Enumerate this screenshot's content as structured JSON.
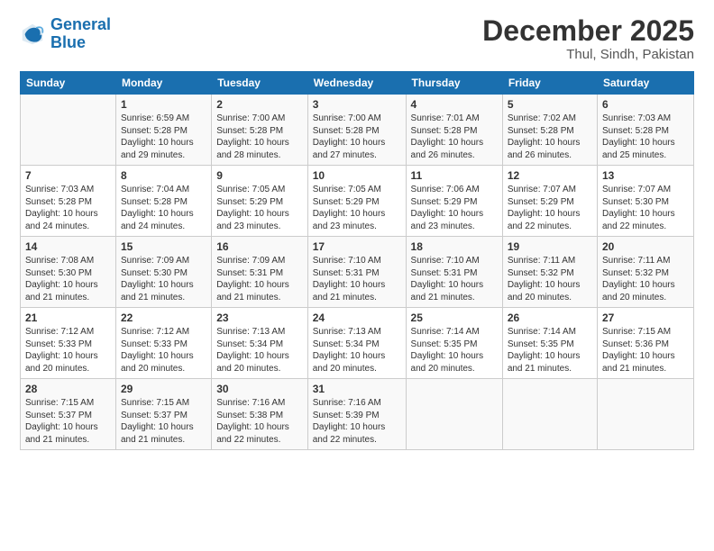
{
  "logo": {
    "text_general": "General",
    "text_blue": "Blue"
  },
  "header": {
    "month": "December 2025",
    "location": "Thul, Sindh, Pakistan"
  },
  "weekdays": [
    "Sunday",
    "Monday",
    "Tuesday",
    "Wednesday",
    "Thursday",
    "Friday",
    "Saturday"
  ],
  "weeks": [
    [
      {
        "day": "",
        "info": ""
      },
      {
        "day": "1",
        "info": "Sunrise: 6:59 AM\nSunset: 5:28 PM\nDaylight: 10 hours\nand 29 minutes."
      },
      {
        "day": "2",
        "info": "Sunrise: 7:00 AM\nSunset: 5:28 PM\nDaylight: 10 hours\nand 28 minutes."
      },
      {
        "day": "3",
        "info": "Sunrise: 7:00 AM\nSunset: 5:28 PM\nDaylight: 10 hours\nand 27 minutes."
      },
      {
        "day": "4",
        "info": "Sunrise: 7:01 AM\nSunset: 5:28 PM\nDaylight: 10 hours\nand 26 minutes."
      },
      {
        "day": "5",
        "info": "Sunrise: 7:02 AM\nSunset: 5:28 PM\nDaylight: 10 hours\nand 26 minutes."
      },
      {
        "day": "6",
        "info": "Sunrise: 7:03 AM\nSunset: 5:28 PM\nDaylight: 10 hours\nand 25 minutes."
      }
    ],
    [
      {
        "day": "7",
        "info": "Sunrise: 7:03 AM\nSunset: 5:28 PM\nDaylight: 10 hours\nand 24 minutes."
      },
      {
        "day": "8",
        "info": "Sunrise: 7:04 AM\nSunset: 5:28 PM\nDaylight: 10 hours\nand 24 minutes."
      },
      {
        "day": "9",
        "info": "Sunrise: 7:05 AM\nSunset: 5:29 PM\nDaylight: 10 hours\nand 23 minutes."
      },
      {
        "day": "10",
        "info": "Sunrise: 7:05 AM\nSunset: 5:29 PM\nDaylight: 10 hours\nand 23 minutes."
      },
      {
        "day": "11",
        "info": "Sunrise: 7:06 AM\nSunset: 5:29 PM\nDaylight: 10 hours\nand 23 minutes."
      },
      {
        "day": "12",
        "info": "Sunrise: 7:07 AM\nSunset: 5:29 PM\nDaylight: 10 hours\nand 22 minutes."
      },
      {
        "day": "13",
        "info": "Sunrise: 7:07 AM\nSunset: 5:30 PM\nDaylight: 10 hours\nand 22 minutes."
      }
    ],
    [
      {
        "day": "14",
        "info": "Sunrise: 7:08 AM\nSunset: 5:30 PM\nDaylight: 10 hours\nand 21 minutes."
      },
      {
        "day": "15",
        "info": "Sunrise: 7:09 AM\nSunset: 5:30 PM\nDaylight: 10 hours\nand 21 minutes."
      },
      {
        "day": "16",
        "info": "Sunrise: 7:09 AM\nSunset: 5:31 PM\nDaylight: 10 hours\nand 21 minutes."
      },
      {
        "day": "17",
        "info": "Sunrise: 7:10 AM\nSunset: 5:31 PM\nDaylight: 10 hours\nand 21 minutes."
      },
      {
        "day": "18",
        "info": "Sunrise: 7:10 AM\nSunset: 5:31 PM\nDaylight: 10 hours\nand 21 minutes."
      },
      {
        "day": "19",
        "info": "Sunrise: 7:11 AM\nSunset: 5:32 PM\nDaylight: 10 hours\nand 20 minutes."
      },
      {
        "day": "20",
        "info": "Sunrise: 7:11 AM\nSunset: 5:32 PM\nDaylight: 10 hours\nand 20 minutes."
      }
    ],
    [
      {
        "day": "21",
        "info": "Sunrise: 7:12 AM\nSunset: 5:33 PM\nDaylight: 10 hours\nand 20 minutes."
      },
      {
        "day": "22",
        "info": "Sunrise: 7:12 AM\nSunset: 5:33 PM\nDaylight: 10 hours\nand 20 minutes."
      },
      {
        "day": "23",
        "info": "Sunrise: 7:13 AM\nSunset: 5:34 PM\nDaylight: 10 hours\nand 20 minutes."
      },
      {
        "day": "24",
        "info": "Sunrise: 7:13 AM\nSunset: 5:34 PM\nDaylight: 10 hours\nand 20 minutes."
      },
      {
        "day": "25",
        "info": "Sunrise: 7:14 AM\nSunset: 5:35 PM\nDaylight: 10 hours\nand 20 minutes."
      },
      {
        "day": "26",
        "info": "Sunrise: 7:14 AM\nSunset: 5:35 PM\nDaylight: 10 hours\nand 21 minutes."
      },
      {
        "day": "27",
        "info": "Sunrise: 7:15 AM\nSunset: 5:36 PM\nDaylight: 10 hours\nand 21 minutes."
      }
    ],
    [
      {
        "day": "28",
        "info": "Sunrise: 7:15 AM\nSunset: 5:37 PM\nDaylight: 10 hours\nand 21 minutes."
      },
      {
        "day": "29",
        "info": "Sunrise: 7:15 AM\nSunset: 5:37 PM\nDaylight: 10 hours\nand 21 minutes."
      },
      {
        "day": "30",
        "info": "Sunrise: 7:16 AM\nSunset: 5:38 PM\nDaylight: 10 hours\nand 22 minutes."
      },
      {
        "day": "31",
        "info": "Sunrise: 7:16 AM\nSunset: 5:39 PM\nDaylight: 10 hours\nand 22 minutes."
      },
      {
        "day": "",
        "info": ""
      },
      {
        "day": "",
        "info": ""
      },
      {
        "day": "",
        "info": ""
      }
    ]
  ]
}
